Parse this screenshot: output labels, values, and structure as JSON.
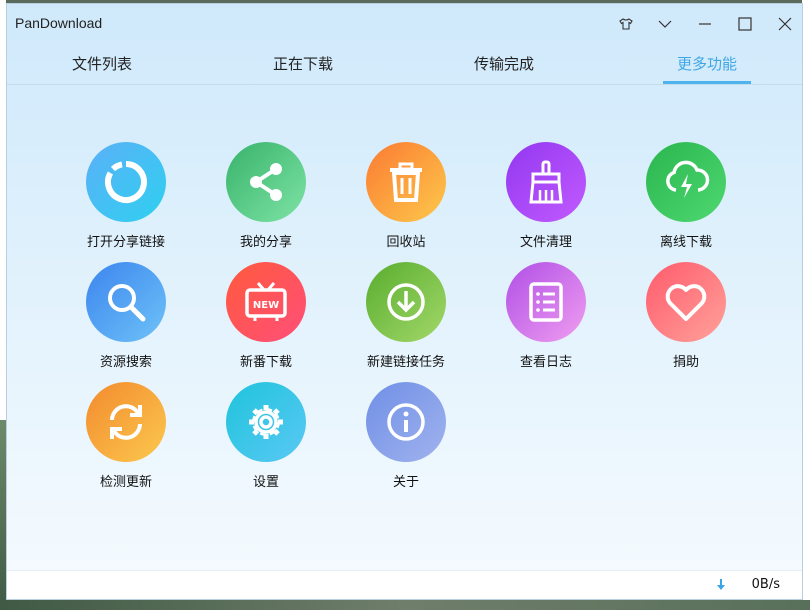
{
  "window": {
    "title": "PanDownload"
  },
  "tabs": [
    {
      "label": "文件列表",
      "active": false
    },
    {
      "label": "正在下载",
      "active": false
    },
    {
      "label": "传输完成",
      "active": false
    },
    {
      "label": "更多功能",
      "active": true
    }
  ],
  "features": [
    {
      "label": "打开分享链接",
      "icon": "share-link-icon",
      "color_from": "#5bb0f7",
      "color_to": "#2fd0f0"
    },
    {
      "label": "我的分享",
      "icon": "share-icon",
      "color_from": "#38b36a",
      "color_to": "#7ee3a6"
    },
    {
      "label": "回收站",
      "icon": "trash-icon",
      "color_from": "#fb7a33",
      "color_to": "#fdc94a"
    },
    {
      "label": "文件清理",
      "icon": "brush-icon",
      "color_from": "#9237f0",
      "color_to": "#c25bff"
    },
    {
      "label": "离线下载",
      "icon": "cloud-download-icon",
      "color_from": "#2ab54f",
      "color_to": "#4fd870"
    },
    {
      "label": "资源搜索",
      "icon": "search-icon",
      "color_from": "#3c85ee",
      "color_to": "#6ec2f8"
    },
    {
      "label": "新番下载",
      "icon": "tv-new-icon",
      "color_from": "#ff5a3c",
      "color_to": "#ff4f7a"
    },
    {
      "label": "新建链接任务",
      "icon": "download-circle-icon",
      "color_from": "#58ad2e",
      "color_to": "#a3d86a"
    },
    {
      "label": "查看日志",
      "icon": "log-icon",
      "color_from": "#b04fe6",
      "color_to": "#f09ef0"
    },
    {
      "label": "捐助",
      "icon": "heart-icon",
      "color_from": "#ff5a6c",
      "color_to": "#ffa29a"
    },
    {
      "label": "检测更新",
      "icon": "refresh-icon",
      "color_from": "#f28a2e",
      "color_to": "#fcc94e"
    },
    {
      "label": "设置",
      "icon": "gear-icon",
      "color_from": "#1fc4dc",
      "color_to": "#5ac8f4"
    },
    {
      "label": "关于",
      "icon": "info-icon",
      "color_from": "#6f8fe6",
      "color_to": "#a1b3ee"
    }
  ],
  "status": {
    "speed": "0B/s"
  }
}
